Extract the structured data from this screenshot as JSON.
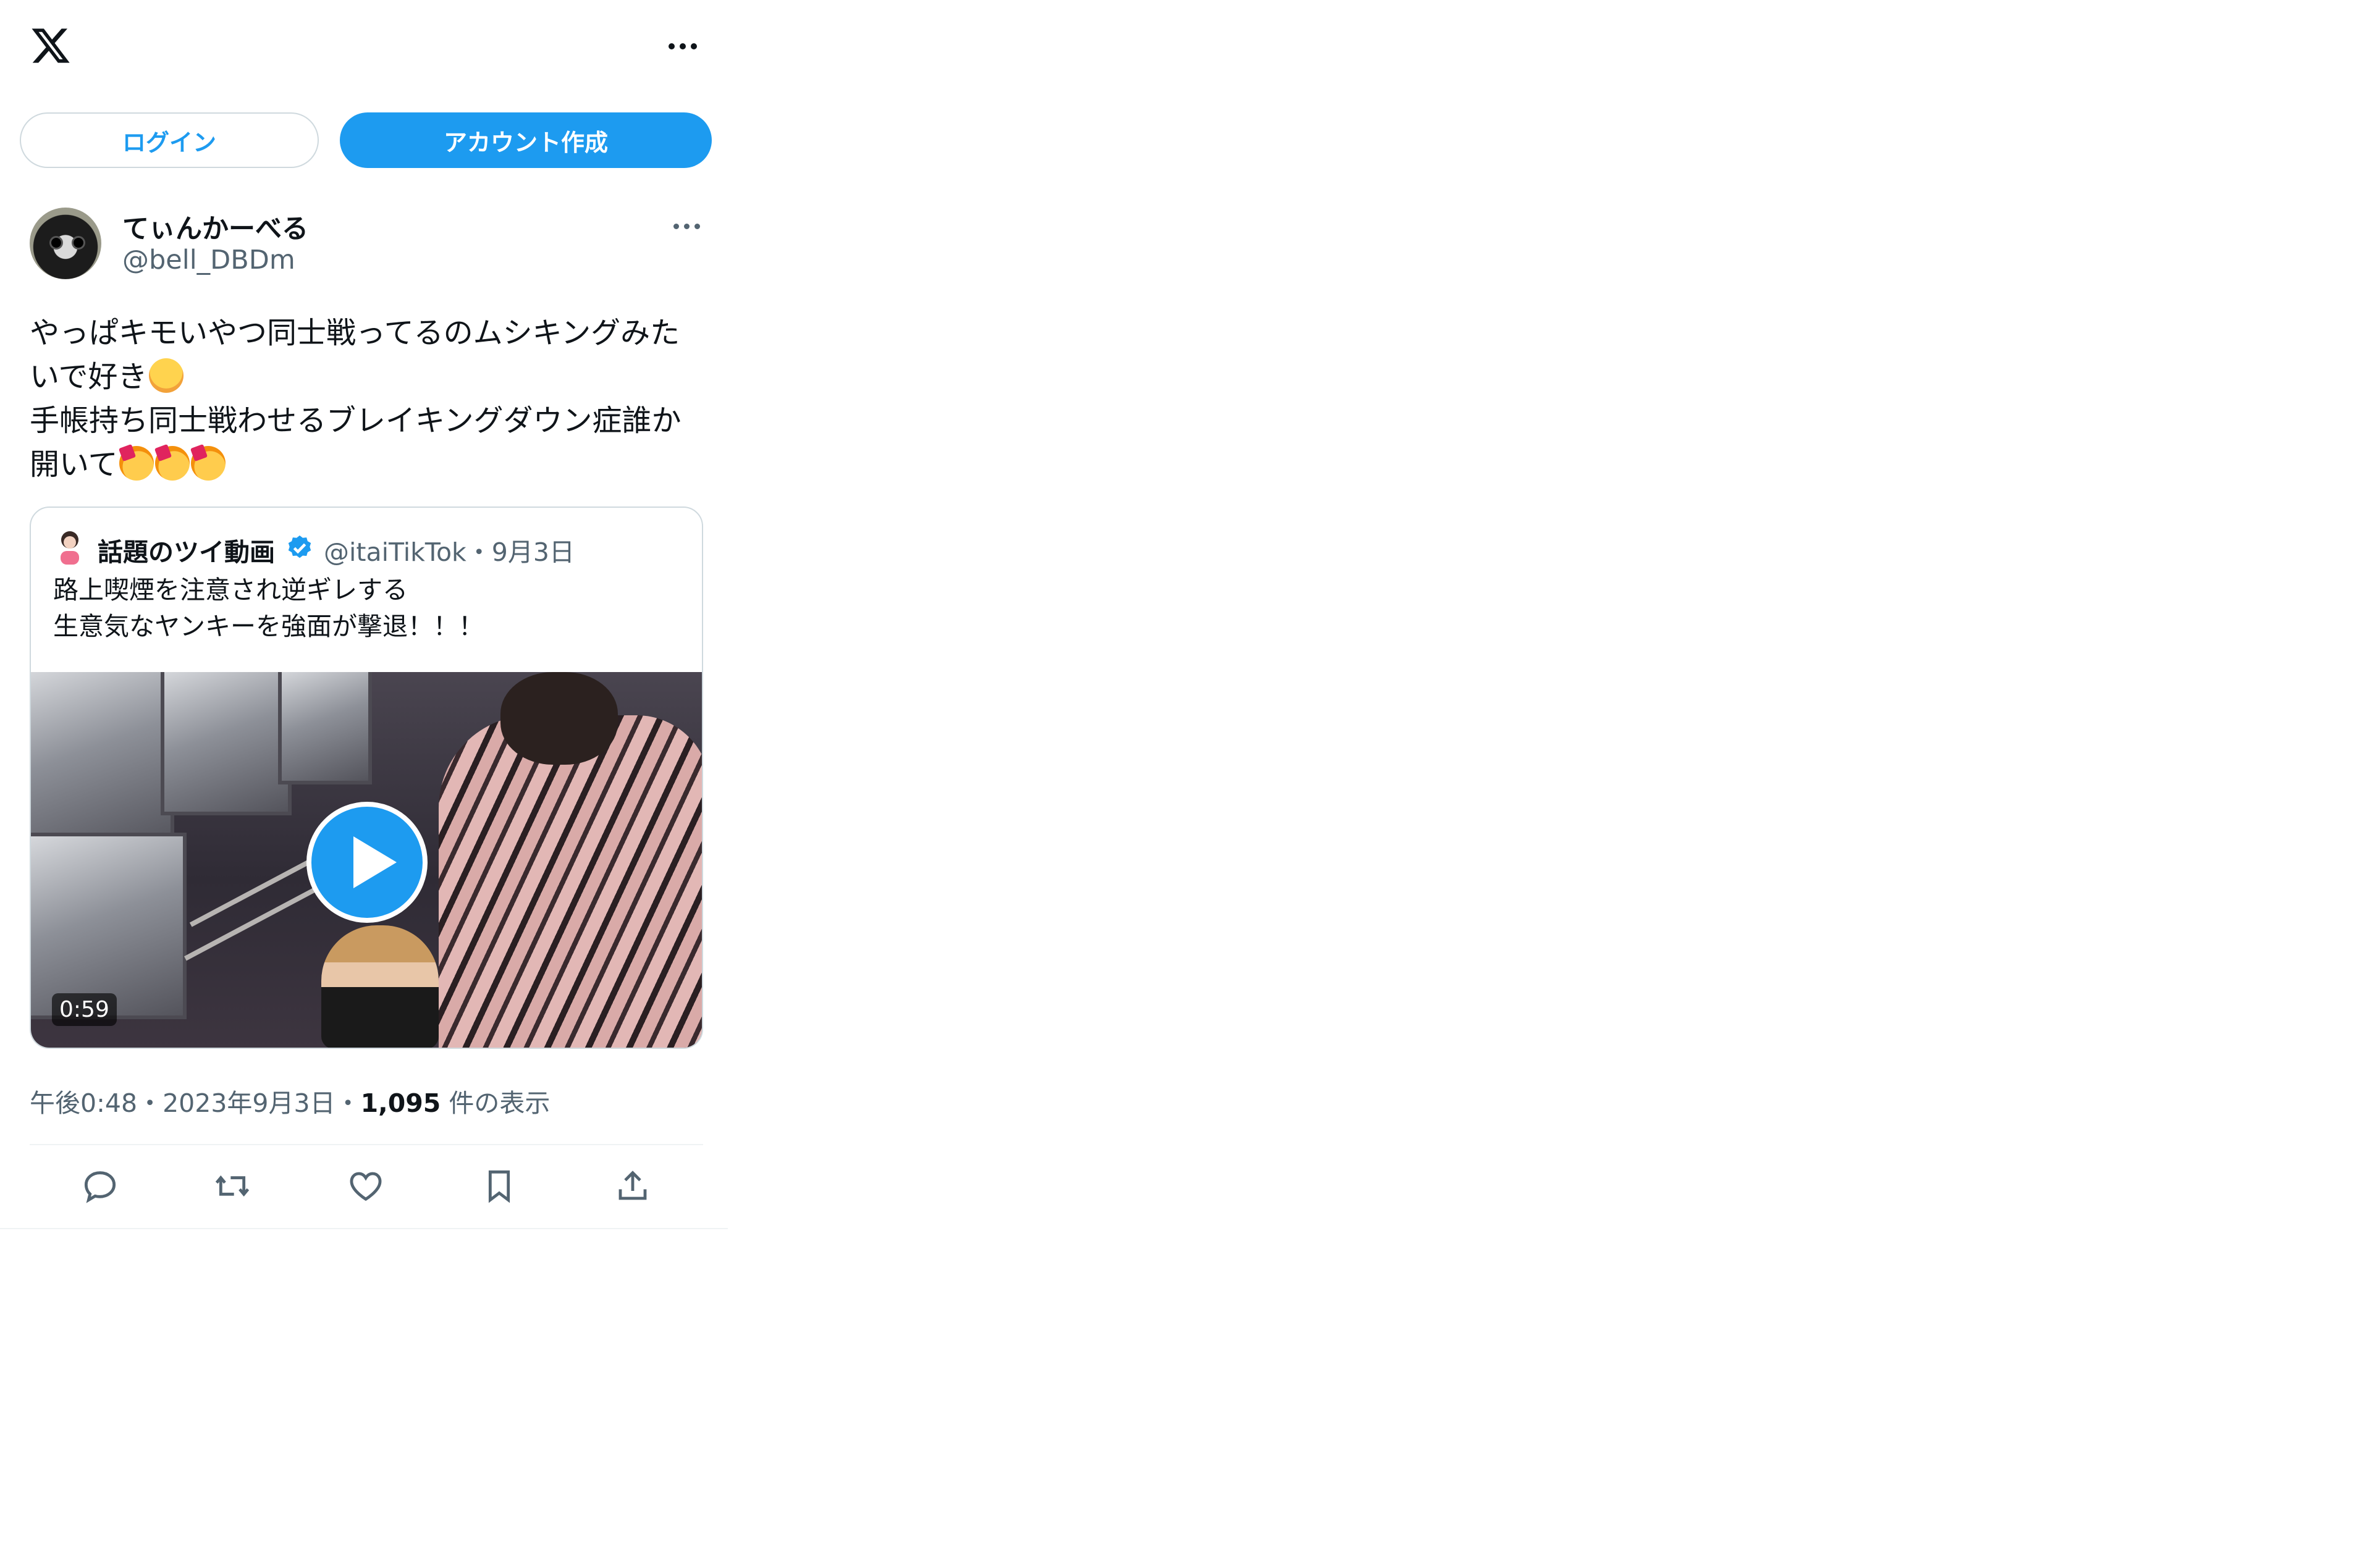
{
  "header": {
    "logo_icon": "x-logo-icon",
    "more_icon": "more-dots-icon"
  },
  "auth": {
    "login_label": "ログイン",
    "signup_label": "アカウント作成"
  },
  "tweet": {
    "author_name": "てぃんかーべる",
    "author_handle": "@bell_DBDm",
    "text_line1": "やっぱキモいやつ同士戦ってるのムシキングみた",
    "text_line2": "いで好き",
    "text_line3": "手帳持ち同士戦わせるブレイキングダウン症誰か",
    "text_line4": "開いて",
    "emoji_1": "smiling-face-emoji",
    "emoji_party": "partying-face-emoji"
  },
  "quote": {
    "author_name": "話題のツイ動画",
    "verified_icon": "verified-badge-icon",
    "meta": "@itaiTikTok・9月3日",
    "text_line1": "路上喫煙を注意され逆ギレする",
    "text_line2": "生意気なヤンキーを強面が撃退！！！",
    "video_duration": "0:59"
  },
  "tweet_meta": {
    "time": "午後0:48・2023年9月3日・",
    "views_count": "1,095",
    "views_label": " 件の表示"
  },
  "colors": {
    "accent": "#1d9bf0",
    "text": "#0f1419",
    "secondary": "#536471",
    "border": "#cfd9de"
  }
}
